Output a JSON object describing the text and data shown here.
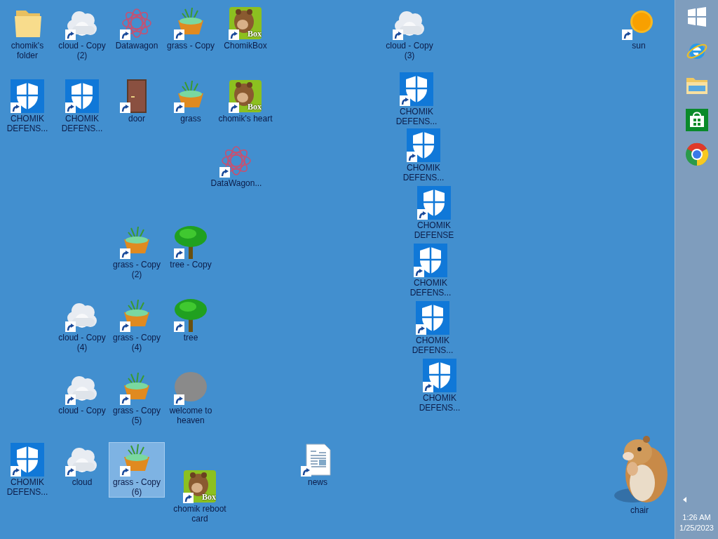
{
  "desktop": {
    "icons": [
      {
        "label": "chomik's folder",
        "kind": "folder",
        "shortcut": false,
        "selected": false
      },
      {
        "label": "cloud - Copy (2)",
        "kind": "cloud",
        "shortcut": true,
        "selected": false
      },
      {
        "label": "Datawagon",
        "kind": "mandala",
        "shortcut": true,
        "selected": false
      },
      {
        "label": "grass - Copy",
        "kind": "grass",
        "shortcut": true,
        "selected": false
      },
      {
        "label": "ChomikBox",
        "kind": "box",
        "badge": "Box",
        "shortcut": true,
        "selected": false
      },
      {
        "label": "cloud - Copy (3)",
        "kind": "cloud",
        "shortcut": true,
        "selected": false
      },
      {
        "label": "sun",
        "kind": "sun",
        "shortcut": true,
        "selected": false
      },
      {
        "label": "CHOMIK DEFENS...",
        "kind": "shield",
        "shortcut": true,
        "selected": false
      },
      {
        "label": "CHOMIK DEFENS...",
        "kind": "shield",
        "shortcut": true,
        "selected": false
      },
      {
        "label": "door",
        "kind": "door",
        "shortcut": true,
        "selected": false
      },
      {
        "label": "grass",
        "kind": "grass",
        "shortcut": true,
        "selected": false
      },
      {
        "label": "chomik's heart",
        "kind": "box",
        "badge": "Box",
        "shortcut": true,
        "selected": false
      },
      {
        "label": "DataWagon...",
        "kind": "mandala",
        "shortcut": true,
        "selected": false
      },
      {
        "label": "CHOMIK DEFENS...",
        "kind": "shield",
        "shortcut": true,
        "selected": false
      },
      {
        "label": "CHOMIK DEFENS...",
        "kind": "shield",
        "shortcut": true,
        "selected": false
      },
      {
        "label": "CHOMIK DEFENSE",
        "kind": "shield",
        "shortcut": true,
        "selected": false
      },
      {
        "label": "CHOMIK DEFENS...",
        "kind": "shield",
        "shortcut": true,
        "selected": false
      },
      {
        "label": "CHOMIK DEFENS...",
        "kind": "shield",
        "shortcut": true,
        "selected": false
      },
      {
        "label": "CHOMIK DEFENS...",
        "kind": "shield",
        "shortcut": true,
        "selected": false
      },
      {
        "label": "grass - Copy (2)",
        "kind": "grass",
        "shortcut": true,
        "selected": false
      },
      {
        "label": "tree - Copy",
        "kind": "tree",
        "shortcut": true,
        "selected": false
      },
      {
        "label": "cloud - Copy (4)",
        "kind": "cloud",
        "shortcut": true,
        "selected": false
      },
      {
        "label": "grass - Copy (4)",
        "kind": "grass",
        "shortcut": true,
        "selected": false
      },
      {
        "label": "tree",
        "kind": "tree",
        "shortcut": true,
        "selected": false
      },
      {
        "label": "cloud - Copy",
        "kind": "cloud",
        "shortcut": true,
        "selected": false
      },
      {
        "label": "grass - Copy (5)",
        "kind": "grass",
        "shortcut": true,
        "selected": false
      },
      {
        "label": "welcome to heaven",
        "kind": "blob",
        "shortcut": true,
        "selected": false
      },
      {
        "label": "CHOMIK DEFENS...",
        "kind": "shield",
        "shortcut": true,
        "selected": false
      },
      {
        "label": "cloud",
        "kind": "cloud",
        "shortcut": true,
        "selected": false
      },
      {
        "label": "grass - Copy (6)",
        "kind": "grass",
        "shortcut": true,
        "selected": true
      },
      {
        "label": "chomik reboot card",
        "kind": "box",
        "badge": "Box",
        "shortcut": true,
        "selected": false
      },
      {
        "label": "news",
        "kind": "news",
        "shortcut": true,
        "selected": false
      },
      {
        "label": "chair",
        "kind": "hidden",
        "shortcut": false,
        "selected": false
      }
    ]
  },
  "desktop_pet": {
    "kind": "hamster"
  },
  "taskbar": {
    "pinned": [
      {
        "kind": "start"
      },
      {
        "kind": "browser"
      },
      {
        "kind": "explorer"
      },
      {
        "kind": "store"
      },
      {
        "kind": "chrome"
      }
    ],
    "clock": {
      "time": "1:26 AM",
      "date": "1/25/2023"
    }
  }
}
